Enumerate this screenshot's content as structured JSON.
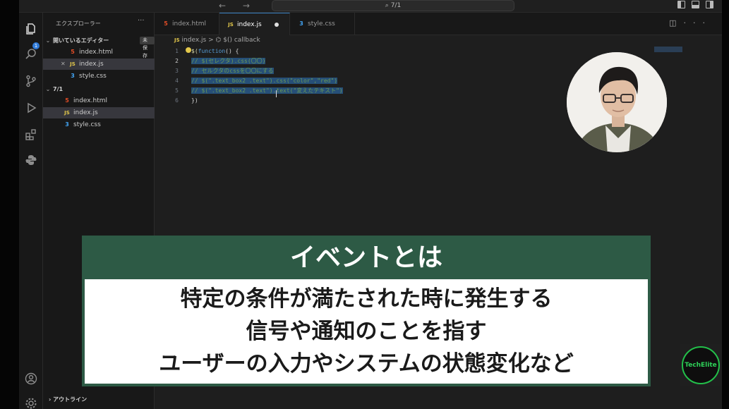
{
  "titlebar": {
    "nav": "← →",
    "search": "⌕ 7/1"
  },
  "activity": {
    "badge": "1"
  },
  "sidebar": {
    "title": "エクスプローラー",
    "more": "···",
    "open_editors": {
      "label": "開いているエディター",
      "unsaved": "未保存 (1)",
      "files": [
        {
          "icon": "5",
          "name": "index.html"
        },
        {
          "icon": "JS",
          "name": "index.js"
        },
        {
          "icon": "3",
          "name": "style.css"
        }
      ]
    },
    "folder": {
      "label": "7/1",
      "files": [
        {
          "icon": "5",
          "name": "index.html"
        },
        {
          "icon": "JS",
          "name": "index.js"
        },
        {
          "icon": "3",
          "name": "style.css"
        }
      ]
    },
    "outline": "アウトライン"
  },
  "tabs": [
    {
      "icon": "5",
      "label": "index.html"
    },
    {
      "icon": "JS",
      "label": "index.js"
    },
    {
      "icon": "3",
      "label": "style.css"
    }
  ],
  "breadcrumb": {
    "icon": "JS",
    "file": "index.js",
    "sep": ">",
    "symbol": "⌬ $() callback"
  },
  "editor": {
    "line_numbers": [
      "1",
      "2",
      "3",
      "4",
      "5",
      "6"
    ],
    "lines": [
      {
        "a": "$(",
        "b": "function",
        "c": "() {"
      },
      {
        "comment": "// $(セレクタ).css(〇〇)"
      },
      {
        "comment": "// セルクタのcssを〇〇にする"
      },
      {
        "comment": "// $(\".text_box2 .text\").css(\"color\",\"red\")"
      },
      {
        "comment": "// $(\".text_box2 .text\").text(\"変えたテキスト\")"
      },
      {
        "a": "})"
      }
    ]
  },
  "caption": {
    "title": "イベントとは",
    "lines": [
      "特定の条件が満たされた時に発生する",
      "信号や通知のことを指す",
      "ユーザーの入力やシステムの状態変化など"
    ]
  },
  "logo": {
    "text": "TechElite"
  },
  "colors": {
    "caption_green": "#2d5a45",
    "selection": "#264f78",
    "accent": "#3b82c4"
  }
}
